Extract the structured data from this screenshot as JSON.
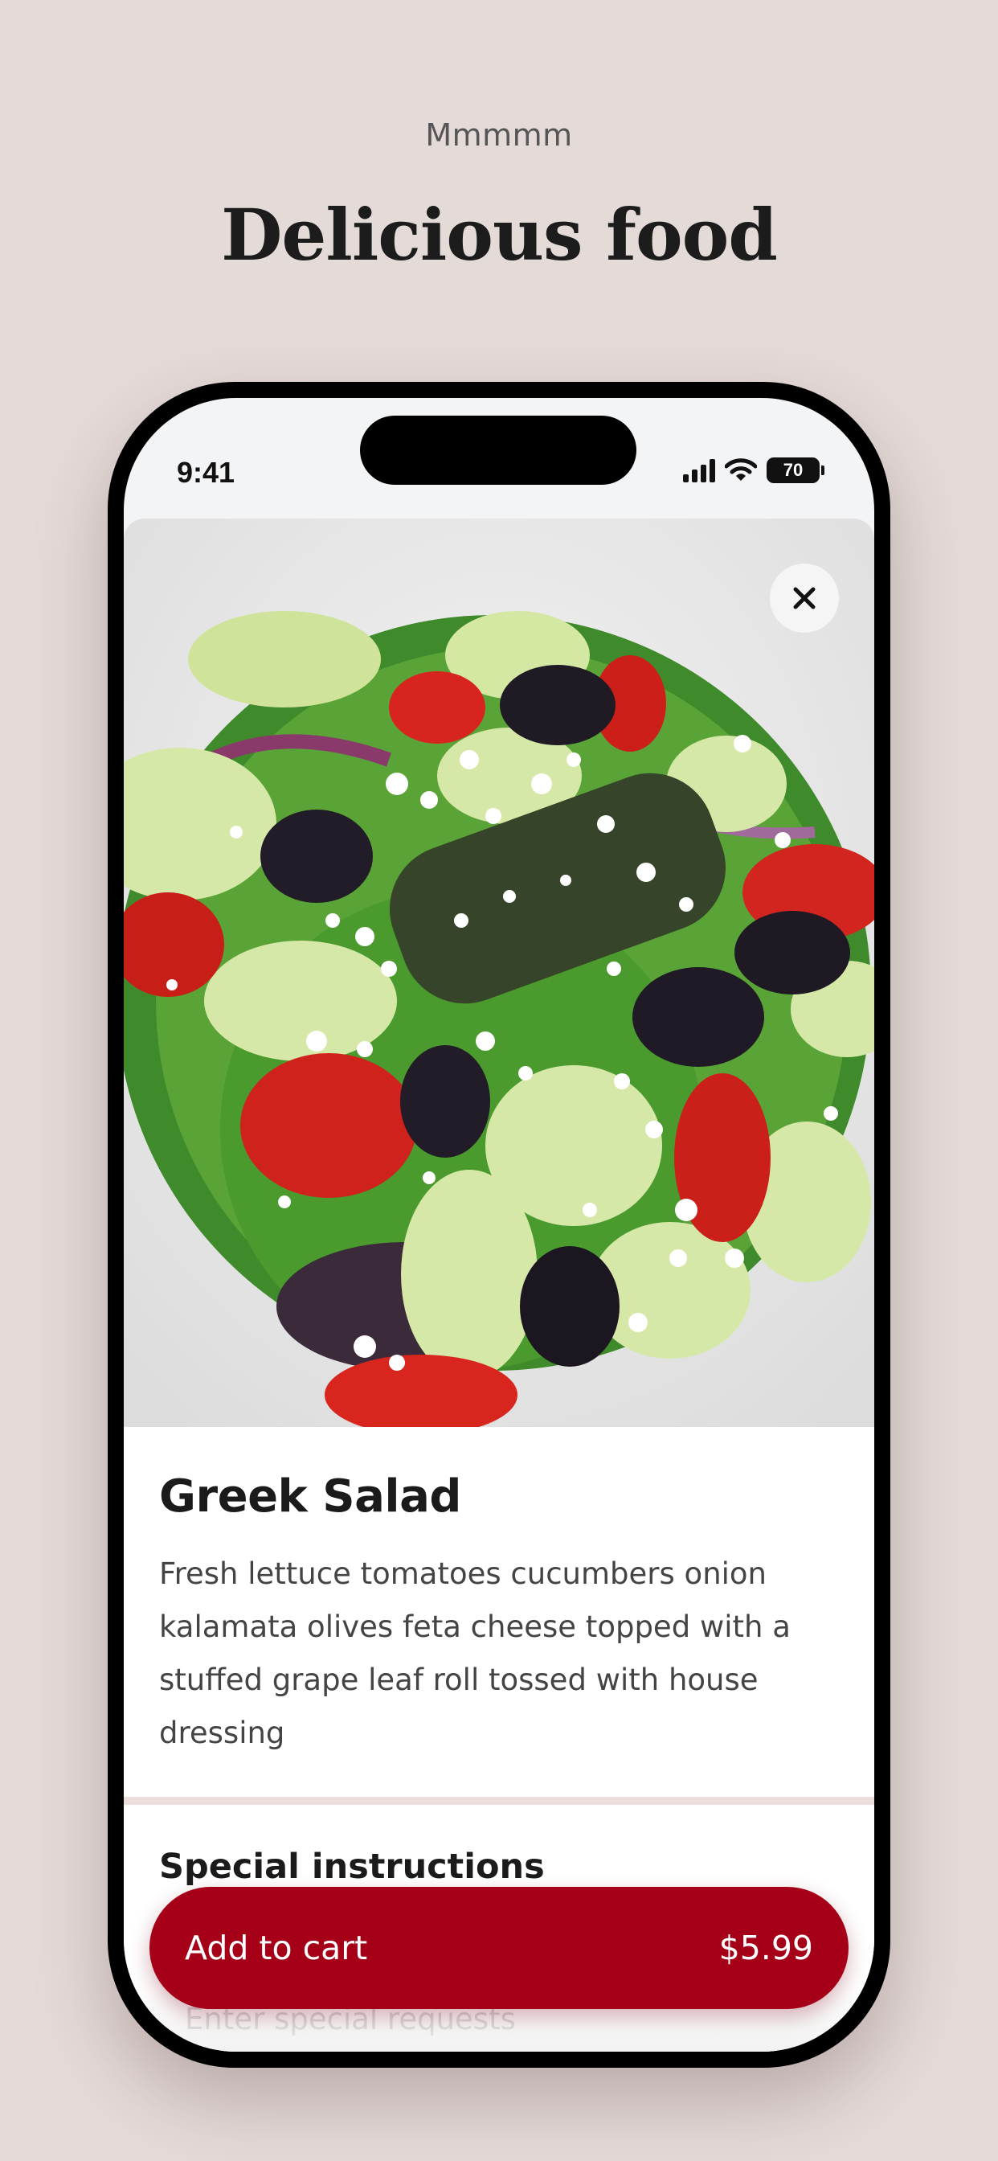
{
  "header": {
    "eyebrow": "Mmmmm",
    "headline": "Delicious food"
  },
  "status_bar": {
    "time": "9:41",
    "battery": "70",
    "icons": [
      "signal-icon",
      "wifi-icon",
      "battery-icon"
    ]
  },
  "item": {
    "image_alt": "Greek salad photo",
    "title": "Greek Salad",
    "description": "Fresh lettuce tomatoes cucumbers onion kalamata olives feta cheese topped with a stuffed grape leaf roll tossed with house dressing"
  },
  "instructions": {
    "title": "Special instructions",
    "placeholder": "Enter special requests"
  },
  "cart_button": {
    "label": "Add to cart",
    "price": "$5.99"
  },
  "colors": {
    "background": "#e4dad8",
    "accent": "#a50017"
  }
}
